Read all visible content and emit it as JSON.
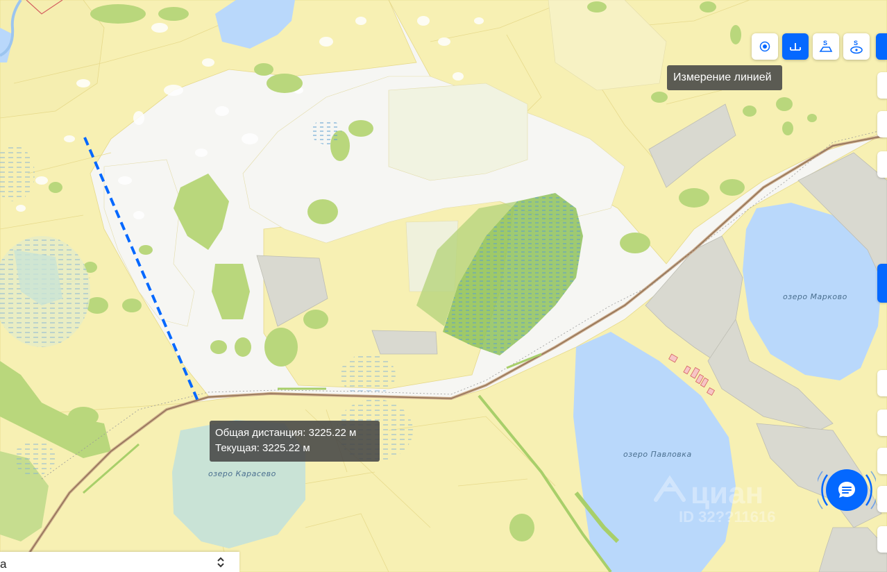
{
  "toolbar": {
    "buttons": [
      {
        "name": "point-tool",
        "icon": "point-icon",
        "active": false
      },
      {
        "name": "line-measure-tool",
        "icon": "ruler-line-icon",
        "active": true
      },
      {
        "name": "polygon-area-tool",
        "icon": "polygon-area-icon",
        "active": false
      },
      {
        "name": "circle-area-tool",
        "icon": "circle-area-icon",
        "active": false
      }
    ],
    "active_tooltip": "Измерение линией"
  },
  "measurement": {
    "total_line": "Общая дистанция: 3225.22 м",
    "current_line": "Текущая: 3225.22 м"
  },
  "map_labels": {
    "lake_markovo": "озеро Марково",
    "lake_pavlovka": "озеро Павловка",
    "lake_karasevo": "озеро Карасево"
  },
  "watermark": {
    "brand": "циан",
    "id_text": "ID 32??11616"
  },
  "bottom_bar": {
    "text": "а"
  },
  "colors": {
    "accent": "#0468ff",
    "field_yellow": "#f7f0b3",
    "forest_green": "#b8d77a",
    "water_blue": "#b9d8fb",
    "quarry_gray": "#d9d9d0"
  },
  "icons": {
    "chat": "chat-bubble-icon",
    "chevron": "chevron-updown-icon"
  }
}
